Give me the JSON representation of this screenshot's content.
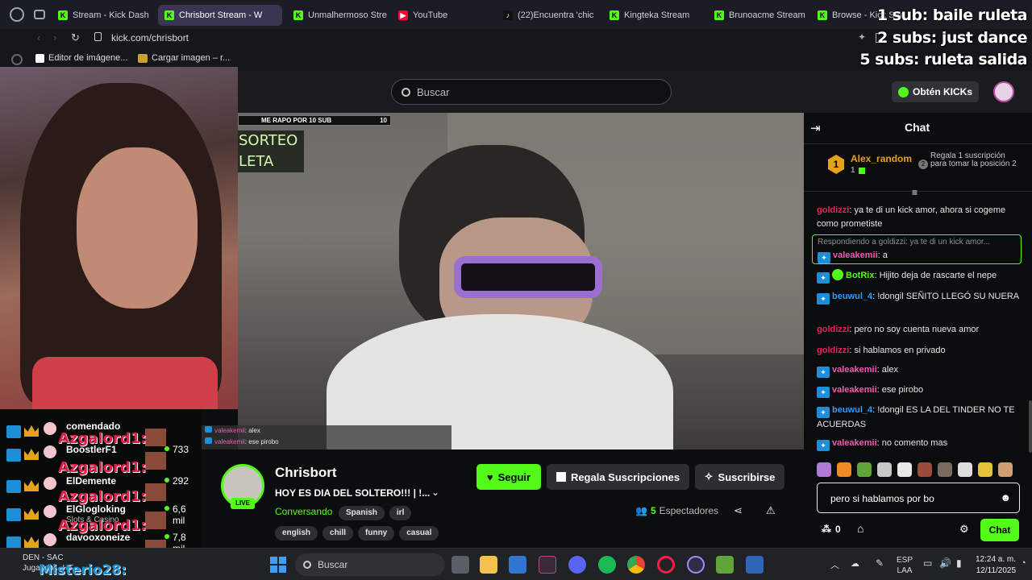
{
  "browser": {
    "tabs": [
      {
        "label": "Stream - Kick Dash",
        "icon": "kick-icon",
        "active": false
      },
      {
        "label": "Chrisbort Stream - W",
        "icon": "kick-icon",
        "active": true
      },
      {
        "label": "Unmalhermoso Stre",
        "icon": "kick-icon",
        "active": false
      },
      {
        "label": "YouTube",
        "icon": "youtube-icon",
        "active": false
      },
      {
        "label": "(22)Encuentra 'chic",
        "icon": "tiktok-icon",
        "active": false
      },
      {
        "label": "Kingteka Stream",
        "icon": "kick-icon",
        "active": false
      },
      {
        "label": "Brunoacme Stream",
        "icon": "kick-icon",
        "active": false
      },
      {
        "label": "Browse - Kick Stre",
        "icon": "kick-icon",
        "active": false
      }
    ],
    "url": "kick.com/chrisbort",
    "bookmarks": [
      "Editor de imágene...",
      "Cargar imagen – r..."
    ]
  },
  "overlay_goals": [
    "1 sub: baile ruleta",
    "2 subs: just dance",
    "5 subs: ruleta salida"
  ],
  "kick": {
    "search_placeholder": "Buscar",
    "kicks_button": "Obtén KICKs",
    "goal_bar": {
      "label": "ME RAPO POR 10 SUB",
      "count": "10"
    },
    "stream_overlay_text": [
      "SORTEO",
      "LETA"
    ],
    "streamer": {
      "name": "Chrisbort",
      "title": "HOY ES DIA DEL SOLTERO!!! | !...",
      "category": "Conversando",
      "language": "Spanish",
      "tags_row1": [
        "irl"
      ],
      "tags_row2": [
        "english",
        "chill",
        "funny",
        "casual"
      ],
      "live_badge": "LIVE",
      "viewers": "5",
      "viewers_label": "Espectadores"
    },
    "buttons": {
      "follow": "Seguir",
      "gift": "Regala Suscripciones",
      "subscribe": "Suscribirse"
    },
    "mini_chat": [
      {
        "user": "valeakemii",
        "text": ": alex"
      },
      {
        "user": "valeakemii",
        "text": ": ese pirobo"
      }
    ]
  },
  "chat": {
    "title": "Chat",
    "top_gifter": {
      "name": "Alex_random",
      "count": "1",
      "rank": "1"
    },
    "gift_promo": "Regala 1 suscripción para tomar la posición 2",
    "gift_promo_count": "2",
    "messages": [
      {
        "user": "goldizzi",
        "color": "#e0245e",
        "badge": "",
        "text": ": ya te di un kick amor, ahora si cogeme como prometiste"
      },
      {
        "reply_to": "Respondiendo a goldizzi: ya te di un kick amor...",
        "user": "valeakemii",
        "color": "#f15bb5",
        "badge": "vip",
        "text": ": a"
      },
      {
        "user": "BotRix",
        "color": "#53fc18",
        "badge": "vip+bot",
        "text": ": Hijito deja de rascarte el nepe"
      },
      {
        "user": "beuwul_4",
        "color": "#2f9bff",
        "badge": "vip",
        "text": ": !dongil SEÑITO LLEGÓ SU NUERA"
      },
      {
        "user": "goldizzi",
        "color": "#e0245e",
        "badge": "",
        "text": ": pero no soy cuenta nueva amor"
      },
      {
        "user": "goldizzi",
        "color": "#e0245e",
        "badge": "",
        "text": ": si hablamos en privado"
      },
      {
        "user": "valeakemii",
        "color": "#f15bb5",
        "badge": "vip",
        "text": ": alex"
      },
      {
        "user": "valeakemii",
        "color": "#f15bb5",
        "badge": "vip",
        "text": ": ese pirobo"
      },
      {
        "user": "beuwul_4",
        "color": "#2f9bff",
        "badge": "vip",
        "text": ": !dongil ES LA DEL TINDER NO TE ACUERDAS"
      },
      {
        "user": "valeakemii",
        "color": "#f15bb5",
        "badge": "vip",
        "text": ": no comento mas"
      }
    ],
    "input_value": "pero si hablamos por bo",
    "kicks_count": "0",
    "send_button": "Chat"
  },
  "follower_overlay": [
    {
      "name": "comendado",
      "value": "",
      "sub": ""
    },
    {
      "name": "BoostlerF1",
      "value": "733",
      "sub": ""
    },
    {
      "name": "ElDemente",
      "value": "292",
      "sub": ""
    },
    {
      "name": "ElGlogloking",
      "value": "6,6 mil",
      "sub": "Slots & Casino"
    },
    {
      "name": "davooxoneize",
      "value": "7,8 mil",
      "sub": ""
    }
  ],
  "alert_name": "Azgalord1:",
  "alert_name_2": "Misterio28:",
  "weather": {
    "line1": "DEN - SAC",
    "line2": "Jugando... HT",
    "badge": "2"
  },
  "taskbar": {
    "search": "Buscar",
    "lang": "ESP",
    "lang2": "LAA",
    "time": "12:24 a. m.",
    "date": "12/11/2025"
  }
}
